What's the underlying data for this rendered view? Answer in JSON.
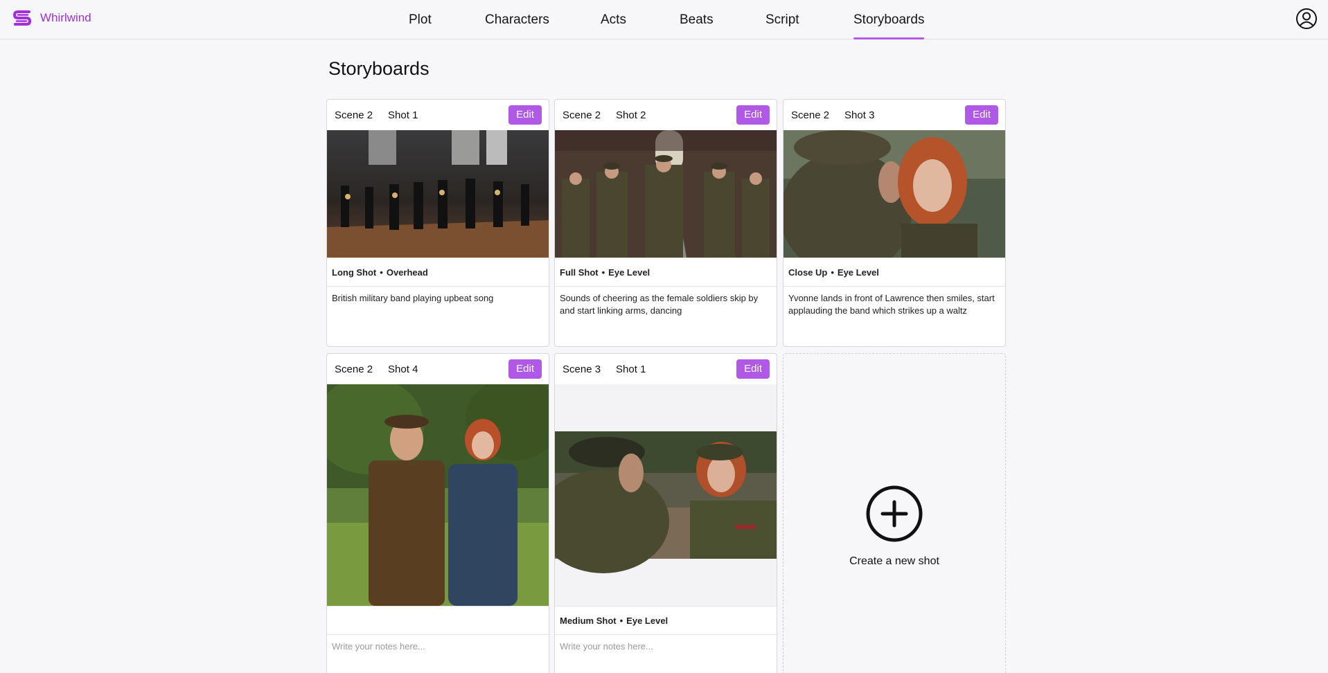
{
  "app": {
    "name": "Whirlwind",
    "brand_color": "#a12fd8",
    "accent_color": "#b059e6"
  },
  "nav": {
    "items": [
      {
        "label": "Plot"
      },
      {
        "label": "Characters"
      },
      {
        "label": "Acts"
      },
      {
        "label": "Beats"
      },
      {
        "label": "Script"
      },
      {
        "label": "Storyboards",
        "active": true
      }
    ]
  },
  "page": {
    "title": "Storyboards"
  },
  "cards": [
    {
      "scene": "Scene 2",
      "shot": "Shot 1",
      "edit_label": "Edit",
      "shot_type": "Long Shot",
      "angle": "Overhead",
      "separator": "•",
      "notes": "British military band playing upbeat song",
      "notes_placeholder": ""
    },
    {
      "scene": "Scene 2",
      "shot": "Shot 2",
      "edit_label": "Edit",
      "shot_type": "Full Shot",
      "angle": "Eye Level",
      "separator": "•",
      "notes": "Sounds of cheering as the female soldiers skip by and start linking arms, dancing",
      "notes_placeholder": ""
    },
    {
      "scene": "Scene 2",
      "shot": "Shot 3",
      "edit_label": "Edit",
      "shot_type": "Close Up",
      "angle": "Eye Level",
      "separator": "•",
      "notes": "Yvonne lands in front of Lawrence then smiles, start applauding the band which strikes up a waltz",
      "notes_placeholder": ""
    },
    {
      "scene": "Scene 2",
      "shot": "Shot 4",
      "edit_label": "Edit",
      "shot_type": "",
      "angle": "",
      "separator": "",
      "notes": "",
      "notes_placeholder": "Write your notes here..."
    },
    {
      "scene": "Scene 3",
      "shot": "Shot 1",
      "edit_label": "Edit",
      "shot_type": "Medium Shot",
      "angle": "Eye Level",
      "separator": "•",
      "notes": "",
      "notes_placeholder": "Write your notes here..."
    }
  ],
  "create": {
    "label": "Create a new shot"
  }
}
